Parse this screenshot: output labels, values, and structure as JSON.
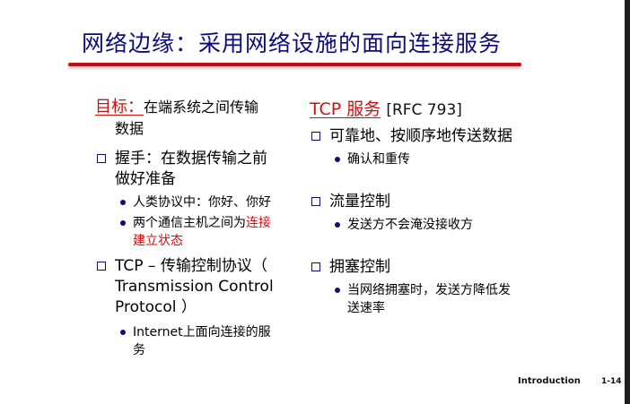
{
  "title": "网络边缘：采用网络设施的面向连接服务",
  "left": {
    "goal_label": "目标：",
    "goal_text": "在端系统之间传输",
    "goal_text_2": "数据",
    "handshake": {
      "line1": "握手：在数据传输之前",
      "line2": "做好准备",
      "sub1": "人类协议中：你好、你好",
      "sub2_prefix": "两个通信主机之间为",
      "sub2_red1": "连接",
      "sub2_red2": "建立状态"
    },
    "tcp": {
      "line1": "TCP – 传输控制协议（",
      "line2": "Transmission Control",
      "line3": "Protocol ）",
      "sub1_line1": "Internet上面向连接的服",
      "sub1_line2": "务"
    }
  },
  "right": {
    "tcp_service": "TCP 服务",
    "rfc": "[RFC 793]",
    "reliable": "可靠地、按顺序地传送数据",
    "reliable_sub": "确认和重传",
    "flow": "流量控制",
    "flow_sub": "发送方不会淹没接收方",
    "congestion": "拥塞控制",
    "congestion_sub_line1": "当网络拥塞时，发送方降低发",
    "congestion_sub_line2": "送速率"
  },
  "footer": {
    "label": "Introduction",
    "page": "1-14"
  },
  "colors": {
    "title": "#0b0b7a",
    "accent_red": "#cc1111",
    "bullet": "#0b0b7a"
  },
  "icons": {
    "square_bullet": "hollow-square-bullet-icon",
    "dot_bullet": "filled-dot-bullet-icon"
  }
}
